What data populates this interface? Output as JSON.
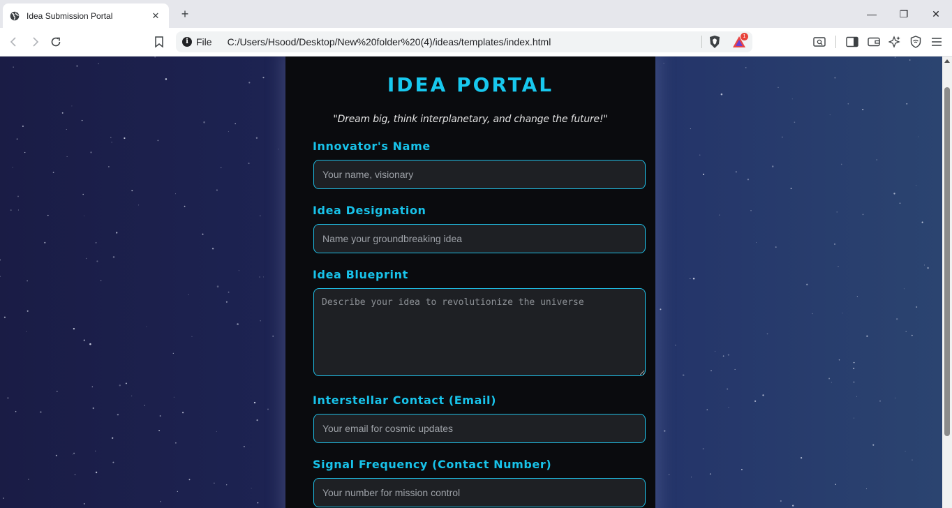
{
  "browser": {
    "tab_title": "Idea Submission Portal",
    "tab_close": "✕",
    "new_tab": "+",
    "address_scheme": "File",
    "url": "C:/Users/Hsood/Desktop/New%20folder%20(4)/ideas/templates/index.html",
    "extension_badge": "1",
    "window_controls": {
      "minimize": "—",
      "restore": "❐",
      "close": "✕"
    }
  },
  "page": {
    "title": "IDEA PORTAL",
    "tagline": "\"Dream big, think interplanetary, and change the future!\"",
    "fields": {
      "name": {
        "label": "Innovator's Name",
        "placeholder": "Your name, visionary"
      },
      "designation": {
        "label": "Idea Designation",
        "placeholder": "Name your groundbreaking idea"
      },
      "blueprint": {
        "label": "Idea Blueprint",
        "placeholder": "Describe your idea to revolutionize the universe"
      },
      "email": {
        "label": "Interstellar Contact (Email)",
        "placeholder": "Your email for cosmic updates"
      },
      "phone": {
        "label": "Signal Frequency (Contact Number)",
        "placeholder": "Your number for mission control"
      }
    }
  },
  "colors": {
    "accent": "#18c8ee",
    "panel_bg": "#0a0b0e",
    "input_bg": "#1e2024",
    "space_left": "#1a1c45",
    "space_right": "#2b4470"
  },
  "icons": [
    "globe-icon",
    "back-icon",
    "forward-icon",
    "reload-icon",
    "bookmark-icon",
    "info-icon",
    "brave-shield-icon",
    "brave-rewards-icon",
    "search-in-page-icon",
    "sidebar-icon",
    "wallet-icon",
    "leo-ai-icon",
    "vpn-icon",
    "menu-icon"
  ]
}
